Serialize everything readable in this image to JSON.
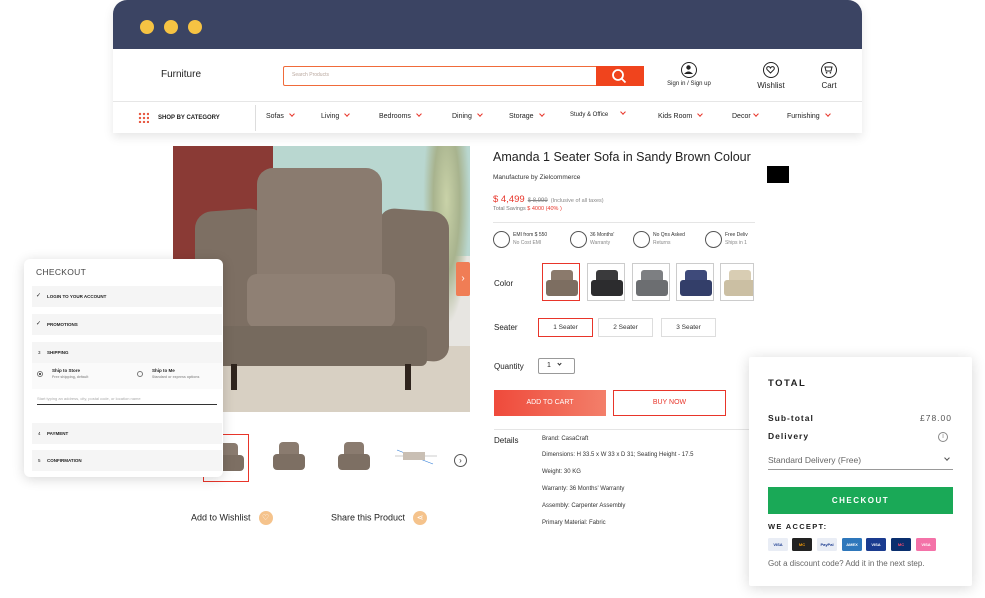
{
  "header": {
    "logo": "Furniture",
    "search_placeholder": "Search Products",
    "signin": "Sign in / Sign up",
    "wishlist": "Wishlist",
    "cart": "Cart"
  },
  "categories": {
    "main": "SHOP BY CATEGORY",
    "items": [
      "Sofas",
      "Living",
      "Bedrooms",
      "Dining",
      "Storage",
      "Study & Office",
      "Kids Room",
      "Decor",
      "Furnishing"
    ]
  },
  "gallery": {
    "add_to_wishlist": "Add to Wishlist",
    "share": "Share this Product"
  },
  "product": {
    "title": "Amanda 1 Seater Sofa in Sandy Brown Colour",
    "manufacturer": "Manufacture by Zielcommerce",
    "price": "$ 4,499",
    "mrp": "$ 8,999",
    "taxes": "(Inclusive of all taxes)",
    "savings_label": "Total Savings",
    "savings_value": "$ 4000 (40% )",
    "features": [
      {
        "title": "EMI from $ 550",
        "sub": "No Cost EMI",
        "icon": "emi-icon"
      },
      {
        "title": "36 Months'",
        "sub": "Warranty",
        "icon": "warranty-shield-icon"
      },
      {
        "title": "No Qns Asked",
        "sub": "Returns",
        "icon": "returns-icon"
      },
      {
        "title": "Free Deliv",
        "sub": "Ships in 1",
        "icon": "delivery-truck-icon"
      }
    ],
    "color_label": "Color",
    "colors": [
      "#8b7a6c",
      "#3a3a3c",
      "#7d7f82",
      "#3e4a7a",
      "#d8cdb3"
    ],
    "seater_label": "Seater",
    "seaters": [
      "1 Seater",
      "2 Seater",
      "3 Seater"
    ],
    "quantity_label": "Quantity",
    "quantity": "1",
    "add_to_cart": "ADD TO CART",
    "buy_now": "BUY NOW",
    "details_label": "Details",
    "details": [
      "Brand: CasaCraft",
      "Dimensions: H 33.5 x W 33 x D 31; Seating Height - 17.5",
      "Weight: 30 KG",
      "Warranty: 36 Months' Warranty",
      "Assembly: Carpenter Assembly",
      "Primary Material: Fabric"
    ]
  },
  "checkout_card": {
    "title": "CHECKOUT",
    "steps": [
      {
        "mark": "✓",
        "label": "LOGIN TO YOUR ACCOUNT"
      },
      {
        "mark": "✓",
        "label": "PROMOTIONS"
      },
      {
        "mark": "3",
        "label": "SHIPPING"
      },
      {
        "mark": "4",
        "label": "PAYMENT"
      },
      {
        "mark": "5",
        "label": "CONFIRMATION"
      }
    ],
    "ship_store": "Ship to Store",
    "ship_store_sub": "Free shipping, default",
    "ship_me": "Ship to Me",
    "ship_me_sub": "Standard or express options",
    "address_placeholder": "Start typing an address, city, postal code, or location name"
  },
  "total_card": {
    "title": "TOTAL",
    "subtotal_label": "Sub-total",
    "subtotal_value": "£78.00",
    "delivery_label": "Delivery",
    "delivery_option": "Standard Delivery (Free)",
    "checkout": "CHECKOUT",
    "accept_label": "WE ACCEPT:",
    "cards": [
      {
        "name": "VISA",
        "color": "#e9edf5",
        "text": "#1a3b8f"
      },
      {
        "name": "MC",
        "color": "#222222",
        "text": "#f59e0b"
      },
      {
        "name": "PayPal",
        "color": "#e9edf5",
        "text": "#1a3b8f"
      },
      {
        "name": "AMEX",
        "color": "#2e77bb",
        "text": "#ffffff"
      },
      {
        "name": "VISA",
        "color": "#1a3b8f",
        "text": "#ffffff"
      },
      {
        "name": "MC",
        "color": "#0a2f6e",
        "text": "#ff4d6d"
      },
      {
        "name": "VISA",
        "color": "#f472a8",
        "text": "#ffffff"
      }
    ],
    "discount_text": "Got a discount code? Add it in the next step."
  }
}
